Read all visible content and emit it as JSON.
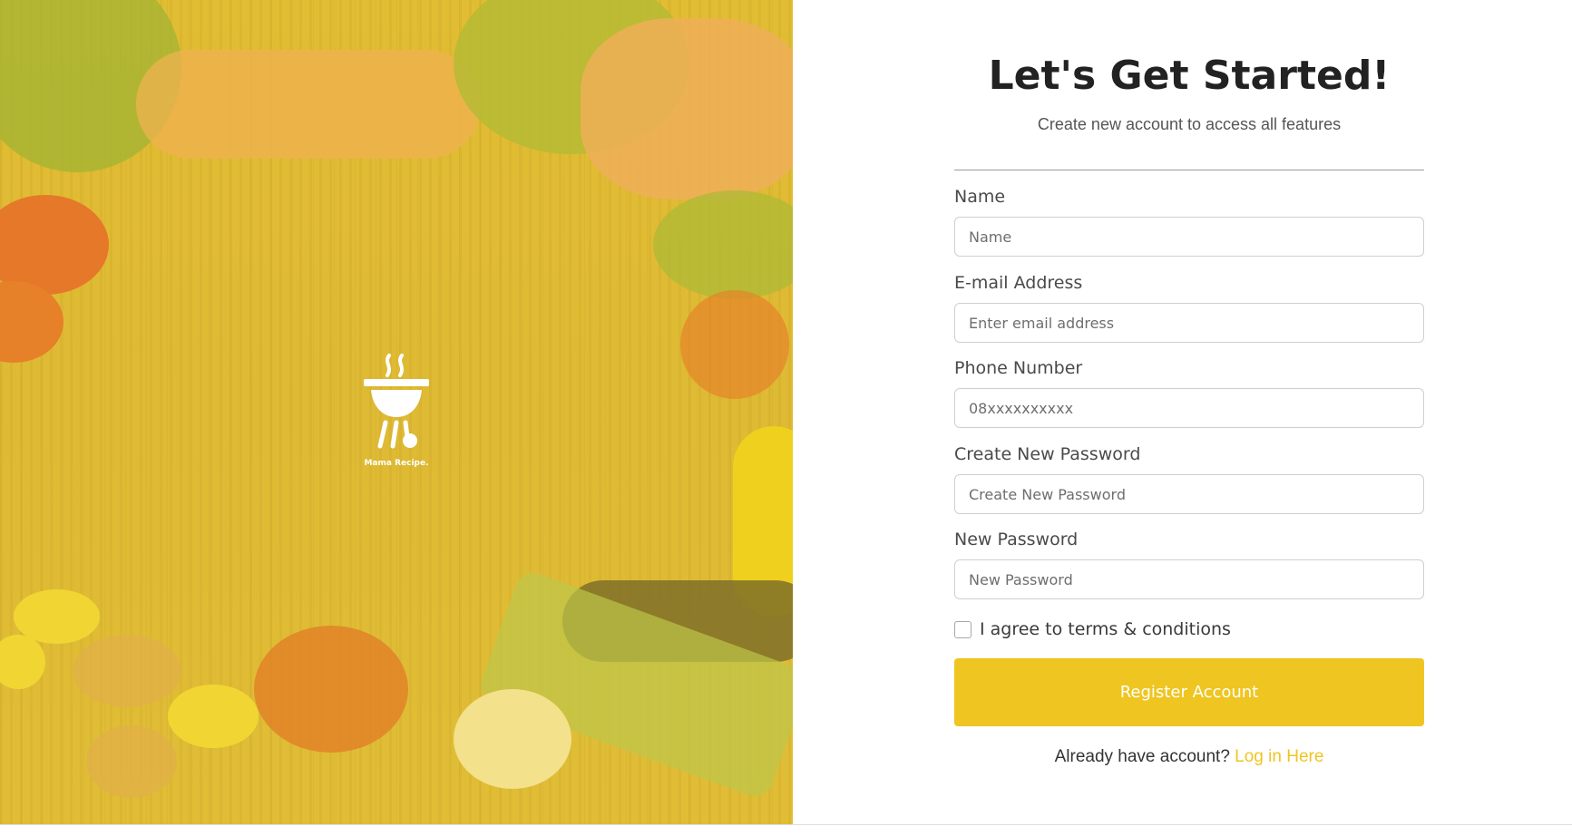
{
  "hero": {
    "brand_name": "Mama Recipe."
  },
  "form": {
    "title": "Let's Get Started!",
    "subtitle": "Create new account to access all features",
    "fields": [
      {
        "label": "Name",
        "placeholder": "Name",
        "value": ""
      },
      {
        "label": "E-mail Address",
        "placeholder": "Enter email address",
        "value": ""
      },
      {
        "label": "Phone Number",
        "placeholder": "08xxxxxxxxxx",
        "value": ""
      },
      {
        "label": "Create New Password",
        "placeholder": "Create New Password",
        "value": ""
      },
      {
        "label": "New Password",
        "placeholder": "New Password",
        "value": ""
      }
    ],
    "agree_label": "I agree to terms & conditions",
    "agree_checked": false,
    "register_label": "Register Account",
    "login_prompt": "Already have account?",
    "login_link": "Log in Here"
  },
  "colors": {
    "accent": "#efc521",
    "title_text": "#222222"
  }
}
